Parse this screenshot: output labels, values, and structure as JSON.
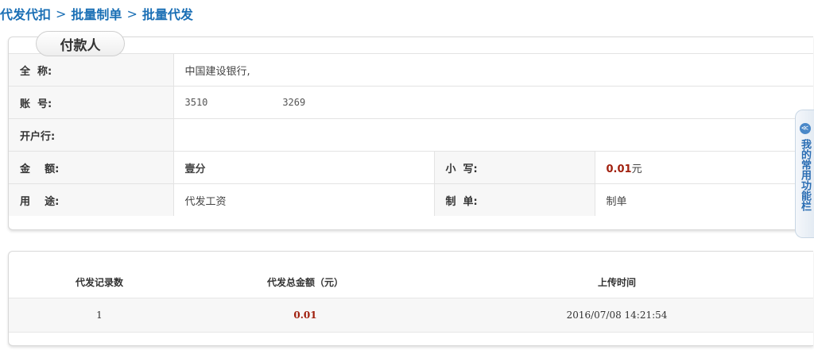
{
  "breadcrumb": {
    "items": [
      "代发代扣",
      "批量制单",
      "批量代发"
    ],
    "separator": ">"
  },
  "payer": {
    "tab_title": "付款人",
    "full_name_label": "全  称:",
    "full_name_value": "中国建设银行,",
    "account_label": "账  号:",
    "account_value_prefix": "3510",
    "account_value_suffix": "3269",
    "bank_label": "开户行:",
    "bank_value": "",
    "amount_label": "金    额:",
    "amount_words": "壹分",
    "amount_small_label": "小  写:",
    "amount_number": "0.01",
    "amount_unit": "元",
    "purpose_label": "用    途:",
    "purpose_value": "代发工资",
    "maker_label": "制  单:",
    "maker_value": "制单"
  },
  "summary": {
    "headers": [
      "代发记录数",
      "代发总金额（元）",
      "上传时间"
    ],
    "row": {
      "count": "1",
      "total": "0.01",
      "upload_time": "2016/07/08 14:21:54"
    }
  },
  "side_panel": {
    "icon_symbol": "≪",
    "label": "我的常用功能栏"
  },
  "colors": {
    "link_blue": "#1a6fb5",
    "amount_red": "#a1210f",
    "label_bg": "#f7f7f7",
    "border": "#e3e3e3"
  }
}
